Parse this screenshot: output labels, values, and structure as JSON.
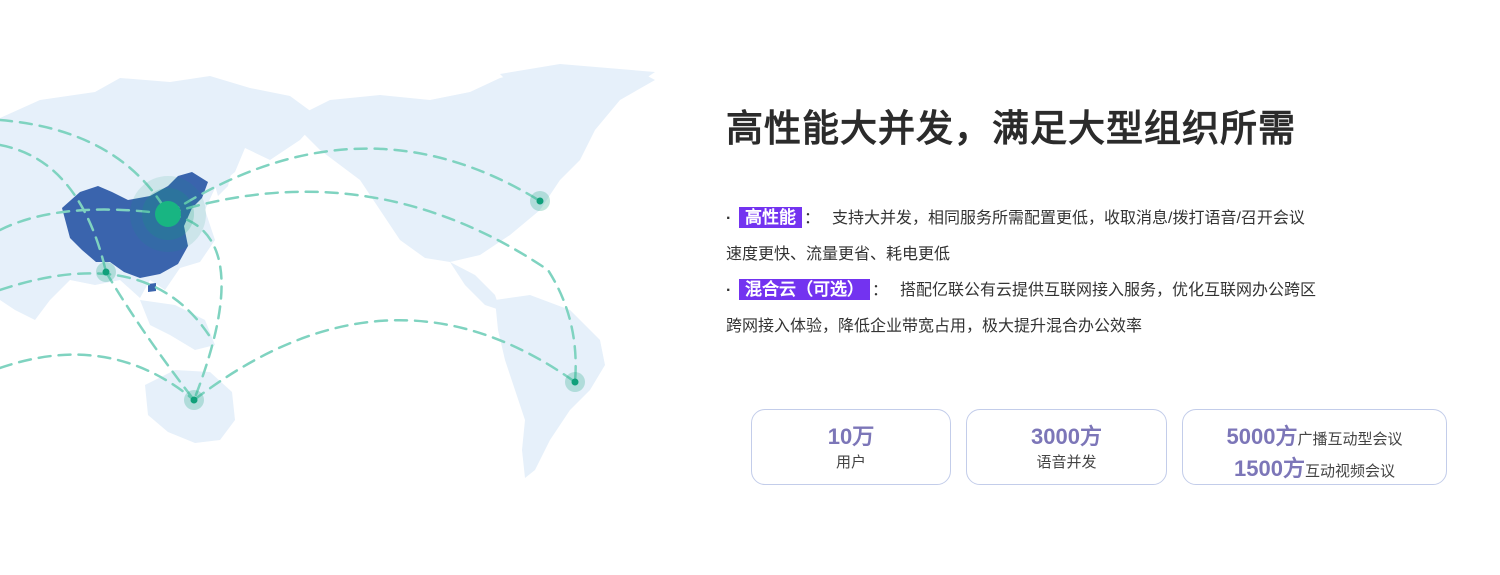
{
  "heading": "高性能大并发，满足大型组织所需",
  "features": [
    {
      "bullet": "·",
      "tag": "高性能",
      "colon": "：",
      "text_line1": "支持大并发，相同服务所需配置更低，收取消息/拨打语音/召开会议",
      "text_line2": "速度更快、流量更省、耗电更低"
    },
    {
      "bullet": "·",
      "tag": "混合云（可选）",
      "colon": "：",
      "text_line1": "搭配亿联公有云提供互联网接入服务，优化互联网办公跨区",
      "text_line2": "跨网接入体验，降低企业带宽占用，极大提升混合办公效率"
    }
  ],
  "stats": {
    "users": {
      "value": "10万",
      "label": "用户"
    },
    "voice": {
      "value": "3000方",
      "label": "语音并发"
    },
    "meetings": {
      "broadcast_value": "5000方",
      "broadcast_label": "广播互动型会议",
      "video_value": "1500方",
      "video_label": "互动视频会议"
    }
  },
  "colors": {
    "accent_purple": "#7333f0",
    "stat_number": "#7c76b8",
    "card_border": "#c3cdea",
    "map_land": "#e6f0fa",
    "china_fill": "#3a64ad",
    "route_line": "#7fd3c0",
    "node_dot": "#10a07a"
  },
  "map": {
    "icon": "world-map-illustration",
    "highlight_region": "china-map-icon"
  }
}
